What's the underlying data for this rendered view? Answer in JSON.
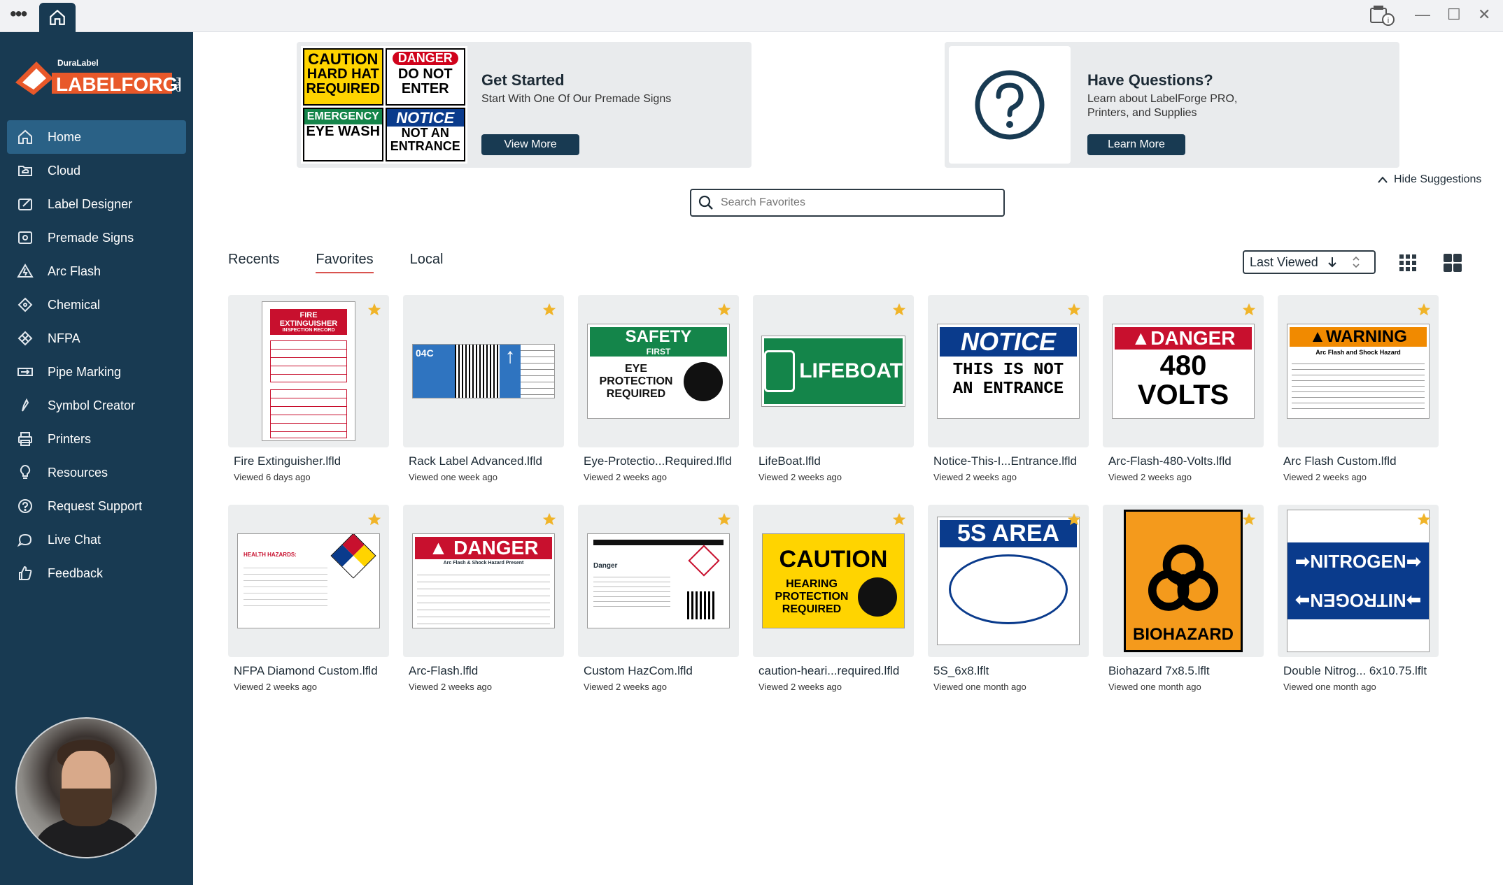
{
  "titlebar": {
    "menu_glyph": "•••",
    "window_controls": {
      "minimize": "—",
      "maximize": "☐",
      "close": "✕"
    }
  },
  "brand": {
    "small": "DuraLabel",
    "name": "LABELFORGE",
    "suffix": "PRO"
  },
  "sidebar": {
    "items": [
      {
        "label": "Home",
        "icon": "home-icon",
        "active": true
      },
      {
        "label": "Cloud",
        "icon": "cloud-folder-icon"
      },
      {
        "label": "Label Designer",
        "icon": "label-designer-icon"
      },
      {
        "label": "Premade Signs",
        "icon": "premade-signs-icon"
      },
      {
        "label": "Arc Flash",
        "icon": "arc-flash-icon"
      },
      {
        "label": "Chemical",
        "icon": "chemical-icon"
      },
      {
        "label": "NFPA",
        "icon": "nfpa-diamond-icon"
      },
      {
        "label": "Pipe Marking",
        "icon": "pipe-marking-icon"
      },
      {
        "label": "Symbol Creator",
        "icon": "symbol-creator-icon"
      },
      {
        "label": "Printers",
        "icon": "printer-icon"
      },
      {
        "label": "Resources",
        "icon": "lightbulb-icon"
      },
      {
        "label": "Request Support",
        "icon": "support-icon"
      },
      {
        "label": "Live Chat",
        "icon": "chat-icon"
      },
      {
        "label": "Feedback",
        "icon": "thumbs-up-icon"
      }
    ]
  },
  "suggestions": {
    "get_started": {
      "title": "Get Started",
      "text": "Start With One Of Our Premade Signs",
      "button": "View More",
      "signs": [
        {
          "head": "CAUTION",
          "body": "HARD HAT REQUIRED"
        },
        {
          "head": "DANGER",
          "body": "DO NOT ENTER"
        },
        {
          "head": "EMERGENCY",
          "body": "EYE WASH"
        },
        {
          "head": "NOTICE",
          "body": "NOT AN ENTRANCE"
        }
      ]
    },
    "questions": {
      "title": "Have Questions?",
      "text_line1": "Learn about LabelForge PRO,",
      "text_line2": "Printers, and Supplies",
      "button": "Learn More"
    },
    "hide": "Hide Suggestions"
  },
  "search": {
    "placeholder": "Search Favorites"
  },
  "tabs": [
    {
      "label": "Recents"
    },
    {
      "label": "Favorites",
      "active": true
    },
    {
      "label": "Local"
    }
  ],
  "sort": {
    "label": "Last Viewed"
  },
  "files": [
    {
      "name": "Fire Extinguisher.lfld",
      "viewed": "Viewed 6 days ago",
      "thumb_text": "FIRE EXTINGUISHER",
      "thumb_sub": "INSPECTION RECORD",
      "kind": "record"
    },
    {
      "name": "Rack Label Advanced.lfld",
      "viewed": "Viewed one week ago",
      "thumb_text": "04C",
      "kind": "rack"
    },
    {
      "name": "Eye-Protectio...Required.lfld",
      "viewed": "Viewed 2 weeks ago",
      "thumb_text": "SAFETY",
      "thumb_sub": "FIRST",
      "thumb_body": "EYE PROTECTION REQUIRED",
      "kind": "safety"
    },
    {
      "name": "LifeBoat.lfld",
      "viewed": "Viewed 2 weeks ago",
      "thumb_text": "LIFEBOAT",
      "kind": "lifeboat"
    },
    {
      "name": "Notice-This-I...Entrance.lfld",
      "viewed": "Viewed 2 weeks ago",
      "thumb_text": "NOTICE",
      "thumb_body": "THIS IS NOT AN ENTRANCE",
      "kind": "notice"
    },
    {
      "name": "Arc-Flash-480-Volts.lfld",
      "viewed": "Viewed 2 weeks ago",
      "thumb_text": "DANGER",
      "thumb_body": "480 VOLTS",
      "kind": "danger480"
    },
    {
      "name": "Arc Flash Custom.lfld",
      "viewed": "Viewed 2 weeks ago",
      "thumb_text": "WARNING",
      "thumb_sub": "Arc Flash and Shock Hazard",
      "kind": "warning"
    },
    {
      "name": "NFPA Diamond Custom.lfld",
      "viewed": "Viewed 2 weeks ago",
      "thumb_text": "HEALTH HAZARDS:",
      "kind": "nfpa"
    },
    {
      "name": "Arc-Flash.lfld",
      "viewed": "Viewed 2 weeks ago",
      "thumb_text": "DANGER",
      "thumb_sub": "Arc Flash & Shock Hazard Present",
      "kind": "dangerarc"
    },
    {
      "name": "Custom HazCom.lfld",
      "viewed": "Viewed 2 weeks ago",
      "thumb_text": "Danger",
      "kind": "hazcom"
    },
    {
      "name": "caution-heari...required.lfld",
      "viewed": "Viewed 2 weeks ago",
      "thumb_text": "CAUTION",
      "thumb_body": "HEARING PROTECTION REQUIRED",
      "kind": "caution"
    },
    {
      "name": "5S_6x8.lflt",
      "viewed": "Viewed one month ago",
      "thumb_text": "5S AREA",
      "kind": "fives"
    },
    {
      "name": "Biohazard 7x8.5.lflt",
      "viewed": "Viewed one month ago",
      "thumb_text": "BIOHAZARD",
      "kind": "bio"
    },
    {
      "name": "Double Nitrog... 6x10.75.lflt",
      "viewed": "Viewed one month ago",
      "thumb_text": "NITROGEN",
      "kind": "nitrogen"
    }
  ],
  "colors": {
    "sidebar": "#183a52",
    "active": "#2a6186",
    "accent_red": "#d9534f",
    "star": "#f0b429"
  }
}
